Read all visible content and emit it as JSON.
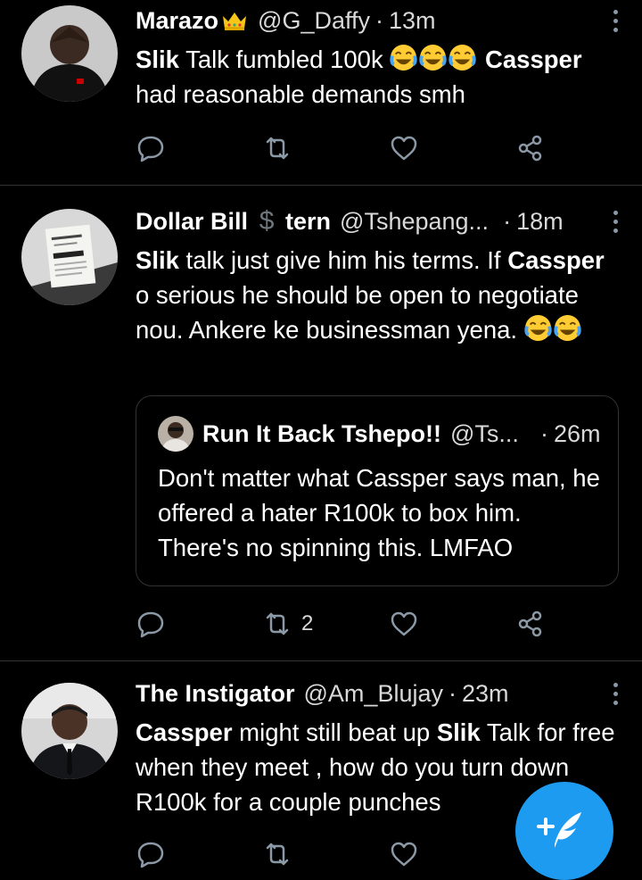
{
  "tweets": [
    {
      "name": "Marazo",
      "handle": "@G_Daffy",
      "time": "13m",
      "text": [
        {
          "t": "Slik",
          "bold": true
        },
        {
          "t": " Talk fumbled 100k "
        },
        {
          "emoji": "joy"
        },
        {
          "emoji": "joy"
        },
        {
          "emoji": "joy"
        },
        {
          "t": " "
        },
        {
          "t": "Cassper",
          "bold": true
        },
        {
          "t": " had reasonable demands smh"
        }
      ],
      "retweets": "",
      "name_badge": "crown-icon"
    },
    {
      "name_part1": "Dollar Bill",
      "name_part2": "tern",
      "handle": "@Tshepang...",
      "time": "18m",
      "text": [
        {
          "t": "Slik",
          "bold": true
        },
        {
          "t": " talk just give him his terms. If "
        },
        {
          "t": "Cassper",
          "bold": true
        },
        {
          "t": " o serious he should be open to negotiate nou. Ankere ke businessman yena. "
        },
        {
          "emoji": "joy"
        },
        {
          "emoji": "joy"
        }
      ],
      "retweets": "2",
      "quote": {
        "name": "Run It Back Tshepo!!",
        "handle": "@Ts...",
        "time": "26m",
        "text": "Don't matter what Cassper says man, he offered a hater R100k to box him. There's no spinning this. LMFAO"
      }
    },
    {
      "name": "The Instigator",
      "handle": "@Am_Blujay",
      "time": "23m",
      "text": [
        {
          "t": "Cassper",
          "bold": true
        },
        {
          "t": " might still beat up "
        },
        {
          "t": "Slik",
          "bold": true
        },
        {
          "t": " Talk for free when they meet , how do you turn down R100k for a couple punches"
        }
      ]
    }
  ],
  "separator": "·",
  "colors": {
    "background": "#000000",
    "text": "#ffffff",
    "secondary": "#8b98a5",
    "divider": "#2f3336",
    "accent": "#1d9bf0"
  },
  "icons": [
    "reply-icon",
    "retweet-icon",
    "like-icon",
    "share-icon",
    "more-icon",
    "compose-icon"
  ]
}
